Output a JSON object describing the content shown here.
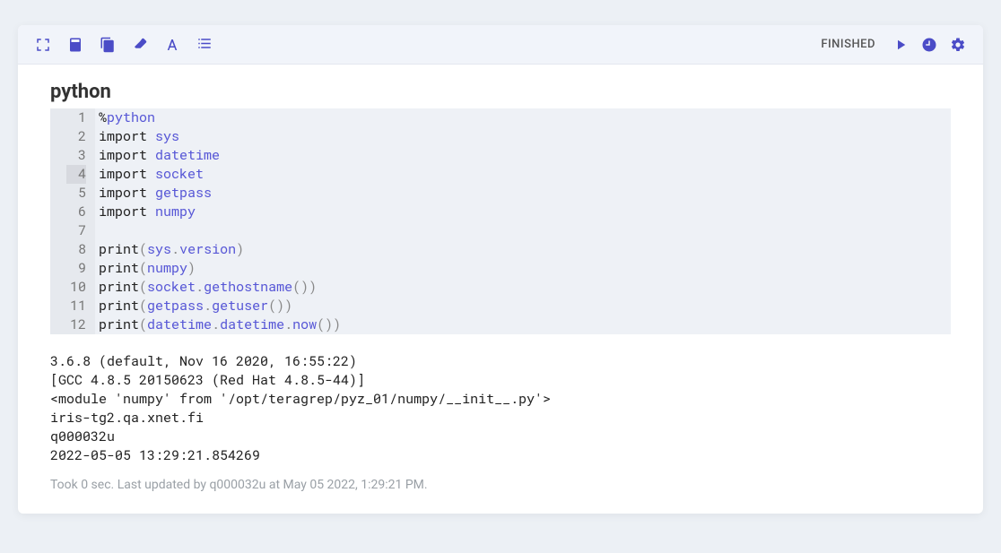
{
  "toolbar": {
    "status": "FINISHED"
  },
  "cell": {
    "title": "python",
    "lines": [
      [
        [
          "%",
          "op"
        ],
        [
          "python",
          "name"
        ]
      ],
      [
        [
          "import ",
          "kw"
        ],
        [
          "sys",
          "name"
        ]
      ],
      [
        [
          "import ",
          "kw"
        ],
        [
          "datetime",
          "name"
        ]
      ],
      [
        [
          "import ",
          "kw"
        ],
        [
          "socket",
          "name"
        ]
      ],
      [
        [
          "import ",
          "kw"
        ],
        [
          "getpass",
          "name"
        ]
      ],
      [
        [
          "import ",
          "kw"
        ],
        [
          "numpy",
          "name"
        ]
      ],
      [],
      [
        [
          "print",
          "func"
        ],
        [
          "(",
          "punc"
        ],
        [
          "sys",
          "name"
        ],
        [
          ".",
          "punc"
        ],
        [
          "version",
          "name"
        ],
        [
          ")",
          "punc"
        ]
      ],
      [
        [
          "print",
          "func"
        ],
        [
          "(",
          "punc"
        ],
        [
          "numpy",
          "name"
        ],
        [
          ")",
          "punc"
        ]
      ],
      [
        [
          "print",
          "func"
        ],
        [
          "(",
          "punc"
        ],
        [
          "socket",
          "name"
        ],
        [
          ".",
          "punc"
        ],
        [
          "gethostname",
          "name"
        ],
        [
          "())",
          "punc"
        ]
      ],
      [
        [
          "print",
          "func"
        ],
        [
          "(",
          "punc"
        ],
        [
          "getpass",
          "name"
        ],
        [
          ".",
          "punc"
        ],
        [
          "getuser",
          "name"
        ],
        [
          "())",
          "punc"
        ]
      ],
      [
        [
          "print",
          "func"
        ],
        [
          "(",
          "punc"
        ],
        [
          "datetime",
          "name"
        ],
        [
          ".",
          "punc"
        ],
        [
          "datetime",
          "name"
        ],
        [
          ".",
          "punc"
        ],
        [
          "now",
          "name"
        ],
        [
          "())",
          "punc"
        ]
      ]
    ],
    "current_line": 4
  },
  "output": "3.6.8 (default, Nov 16 2020, 16:55:22) \n[GCC 4.8.5 20150623 (Red Hat 4.8.5-44)]\n<module 'numpy' from '/opt/teragrep/pyz_01/numpy/__init__.py'>\niris-tg2.qa.xnet.fi\nq000032u\n2022-05-05 13:29:21.854269",
  "footer": "Took 0 sec. Last updated by q000032u at May 05 2022, 1:29:21 PM."
}
